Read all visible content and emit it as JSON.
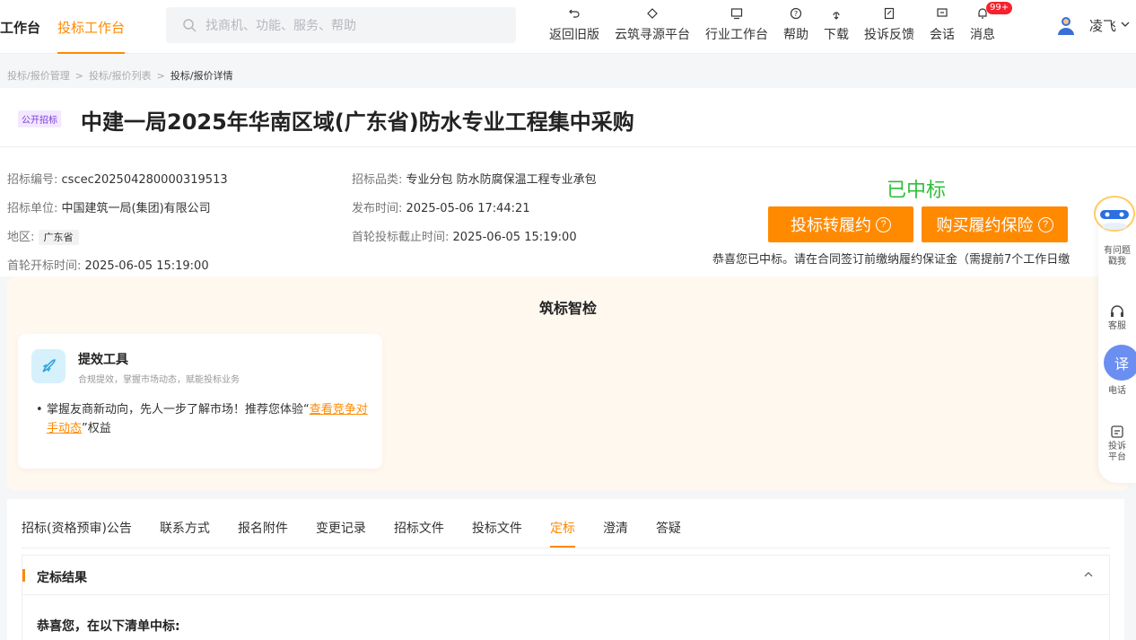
{
  "nav": {
    "tab_workbench": "工作台",
    "tab_bid_workbench": "投标工作台",
    "search_placeholder": "找商机、功能、服务、帮助",
    "items": [
      {
        "label": "返回旧版",
        "icon": "return-icon"
      },
      {
        "label": "云筑寻源平台",
        "icon": "diamond-icon"
      },
      {
        "label": "行业工作台",
        "icon": "monitor-icon"
      },
      {
        "label": "帮助",
        "icon": "help-icon"
      },
      {
        "label": "下载",
        "icon": "download-icon"
      },
      {
        "label": "投诉反馈",
        "icon": "feedback-icon"
      },
      {
        "label": "会话",
        "icon": "chat-icon"
      },
      {
        "label": "消息",
        "icon": "bell-icon",
        "badge": "99+"
      }
    ],
    "user_name": "凌飞"
  },
  "breadcrumb": [
    "投标/报价管理",
    "投标/报价列表",
    "投标/报价详情"
  ],
  "header": {
    "tag": "公开招标",
    "title": "中建一局2025年华南区域(广东省)防水专业工程集中采购"
  },
  "info": {
    "bid_no_label": "招标编号:",
    "bid_no": "cscec202504280000319513",
    "category_label": "招标品类:",
    "category": "专业分包 防水防腐保温工程专业承包",
    "unit_label": "招标单位:",
    "unit": "中国建筑一局(集团)有限公司",
    "publish_label": "发布时间:",
    "publish_time": "2025-05-06 17:44:21",
    "region_label": "地区:",
    "region": "广东省",
    "deadline_label": "首轮投标截止时间:",
    "deadline": "2025-06-05 15:19:00",
    "open_label": "首轮开标时间:",
    "open_time": "2025-06-05 15:19:00"
  },
  "status": {
    "won": "已中标",
    "btn_convert": "投标转履约",
    "btn_insurance": "购买履约保险",
    "notice": "恭喜您已中标。请在合同签订前缴纳履约保证金（需提前7个工作日缴"
  },
  "smart": {
    "title": "筑标智检",
    "tool_name": "提效工具",
    "tool_desc": "合规提效，掌握市场动态，赋能投标业务",
    "text_before": "掌握友商新动向，先人一步了解市场！推荐您体验“",
    "text_link": "查看竞争对手动态",
    "text_after": "”权益"
  },
  "tabs": [
    "招标(资格预审)公告",
    "联系方式",
    "报名附件",
    "变更记录",
    "招标文件",
    "投标文件",
    "定标",
    "澄清",
    "答疑"
  ],
  "active_tab": "定标",
  "result": {
    "title": "定标结果",
    "congrats": "恭喜您，在以下清单中标:"
  },
  "sidebar": {
    "help": "有问题\n戳我",
    "service": "客服",
    "phone": "电话",
    "translate": "译",
    "complaint": "投诉\n平台"
  },
  "colors": {
    "accent": "#ff8a00",
    "success": "#2fbf3a",
    "badge": "#f5222d"
  }
}
